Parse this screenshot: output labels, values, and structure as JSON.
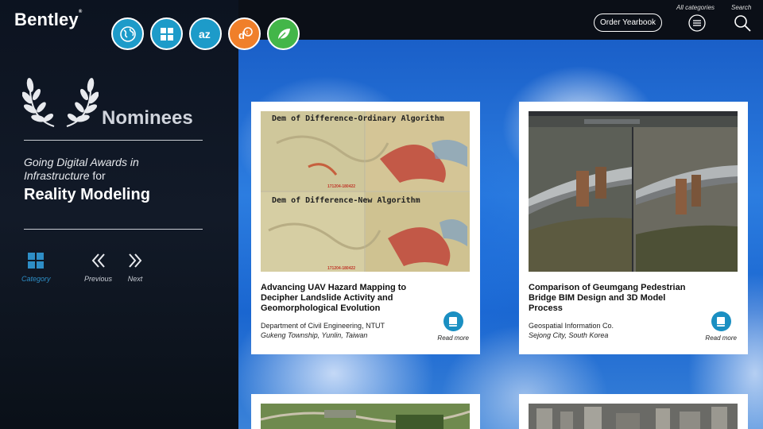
{
  "brand": {
    "logo": "Bentley"
  },
  "categories": [
    {
      "name": "globe-icon",
      "color": "#1d9bc9"
    },
    {
      "name": "grid-icon",
      "color": "#1d9bc9"
    },
    {
      "name": "az-icon",
      "color": "#1d9bc9"
    },
    {
      "name": "dt-icon",
      "color": "#f07f2a"
    },
    {
      "name": "leaf-icon",
      "color": "#43b649"
    }
  ],
  "header": {
    "order_button": "Order Yearbook",
    "all_categories_label": "All categories",
    "search_label": "Search"
  },
  "sidebar": {
    "heading": "Nominees",
    "subtitle_italic": "Going Digital Awards in Infrastructure",
    "subtitle_for": "for",
    "category_title": "Reality Modeling",
    "nav": {
      "category": "Category",
      "previous": "Previous",
      "next": "Next"
    }
  },
  "cards": [
    {
      "title": "Advancing UAV Hazard Mapping to Decipher Landslide Activity and Geomorphological Evolution",
      "org": "Department of Civil Engineering, NTUT",
      "location": "Gukeng Township, Yunlin, Taiwan",
      "read_more": "Read more",
      "image_labels": {
        "top": "Dem of Difference-Ordinary Algorithm",
        "bottom": "Dem of Difference-New Algorithm",
        "code_top": "171204-180422",
        "code_bottom": "171204-180422"
      }
    },
    {
      "title": "Comparison of Geumgang Pedestrian Bridge BIM Design and 3D Model Process",
      "org": "Geospatial Information Co.",
      "location": "Sejong City, South Korea",
      "read_more": "Read more"
    }
  ],
  "colors": {
    "accent": "#1d9bc9",
    "orange": "#f07f2a",
    "green": "#43b649"
  }
}
